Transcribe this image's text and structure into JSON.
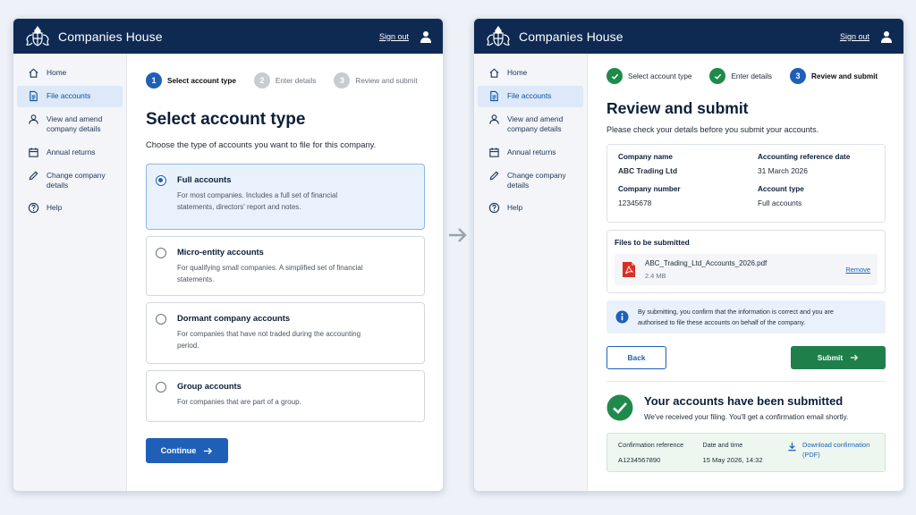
{
  "left": {
    "brand": "Companies House",
    "signout": "Sign out",
    "nav": [
      {
        "label": "Home",
        "icon": "home-icon"
      },
      {
        "label": "File accounts",
        "icon": "document-icon",
        "active": true
      },
      {
        "label": "View and amend company details",
        "icon": "person-icon"
      },
      {
        "label": "Annual returns",
        "icon": "calendar-icon"
      },
      {
        "label": "Change company details",
        "icon": "pencil-icon"
      },
      {
        "label": "Help",
        "icon": "help-icon"
      }
    ],
    "steps": [
      {
        "num": "1",
        "label": "Select account type"
      },
      {
        "num": "2",
        "label": "Enter details"
      },
      {
        "num": "3",
        "label": "Review and submit"
      }
    ],
    "title": "Select account type",
    "subtitle": "Choose the type of accounts you want to file for this company.",
    "options": [
      {
        "title": "Full accounts",
        "desc": "For most companies. Includes a full set of financial statements, directors' report and notes.",
        "selected": true
      },
      {
        "title": "Micro-entity accounts",
        "desc": "For qualifying small companies. A simplified set of financial statements."
      },
      {
        "title": "Dormant company accounts",
        "desc": "For companies that have not traded during the accounting period."
      },
      {
        "title": "Group accounts",
        "desc": "For companies that are part of a group."
      }
    ],
    "continue": "Continue"
  },
  "right": {
    "brand": "Companies House",
    "signout": "Sign out",
    "nav": [
      {
        "label": "Home",
        "icon": "home-icon"
      },
      {
        "label": "File accounts",
        "icon": "document-icon",
        "active": true
      },
      {
        "label": "View and amend company details",
        "icon": "person-icon"
      },
      {
        "label": "Annual returns",
        "icon": "calendar-icon"
      },
      {
        "label": "Change company details",
        "icon": "pencil-icon"
      },
      {
        "label": "Help",
        "icon": "help-icon"
      }
    ],
    "steps": [
      {
        "num": "",
        "label": "Select account type"
      },
      {
        "num": "",
        "label": "Enter details"
      },
      {
        "num": "3",
        "label": "Review and submit"
      }
    ],
    "title": "Review and submit",
    "subtitle": "Please check your details before you submit your accounts.",
    "details": {
      "company_name_label": "Company name",
      "company_name": "ABC Trading Ltd",
      "ard_label": "Accounting reference date",
      "ard": "31 March 2026",
      "company_number_label": "Company number",
      "company_number": "12345678",
      "account_type_label": "Account type",
      "account_type": "Full accounts"
    },
    "files": {
      "title": "Files to be submitted",
      "filename": "ABC_Trading_Ltd_Accounts_2026.pdf",
      "size": "2.4 MB",
      "remove": "Remove"
    },
    "info": "By submitting, you confirm that the information is correct and you are authorised to file these accounts on behalf of the company.",
    "back": "Back",
    "submit": "Submit",
    "success_title": "Your accounts have been submitted",
    "success_sub": "We've received your filing. You'll get a confirmation email shortly.",
    "confirmation": {
      "ref_label": "Confirmation reference",
      "ref": "A1234567890",
      "date_label": "Date and time",
      "date": "15 May 2026, 14:32",
      "download": "Download confirmation (PDF)"
    }
  },
  "colors": {
    "header": "#0e2a52",
    "primary": "#1f5fb8",
    "success": "#1f8a4c"
  }
}
